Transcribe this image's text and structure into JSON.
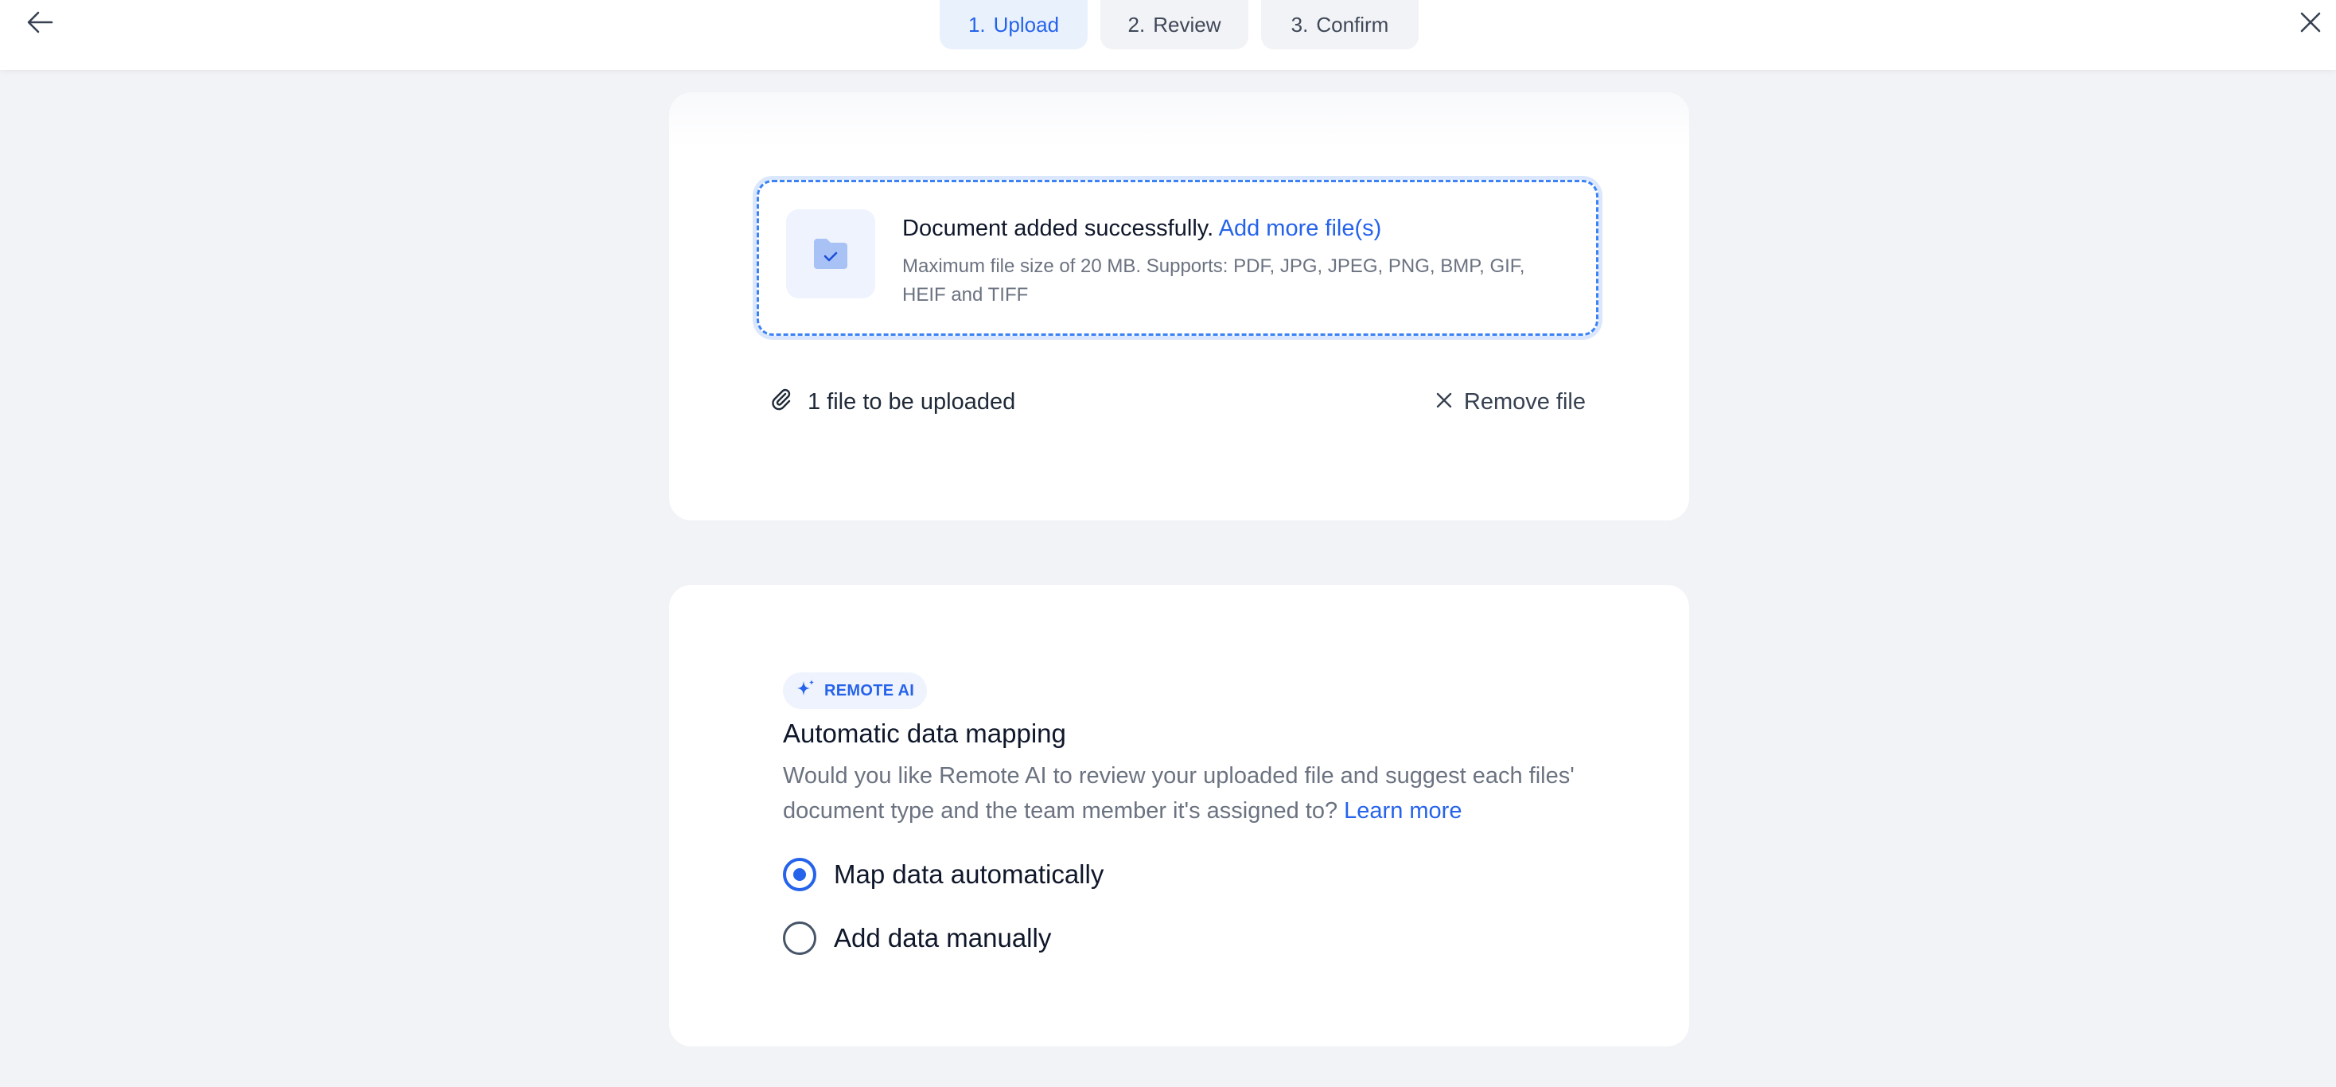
{
  "header": {
    "steps": [
      {
        "number": "1.",
        "label": "Upload",
        "active": true
      },
      {
        "number": "2.",
        "label": "Review",
        "active": false
      },
      {
        "number": "3.",
        "label": "Confirm",
        "active": false
      }
    ],
    "back_icon": "arrow-left-icon",
    "close_icon": "close-icon"
  },
  "upload": {
    "status_text": "Document added successfully.",
    "add_more_link": "Add more file(s)",
    "hint": "Maximum file size of 20 MB. Supports: PDF, JPG, JPEG, PNG, BMP, GIF, HEIF and TIFF",
    "file_count": "1 file to be uploaded",
    "remove_label": "Remove file",
    "folder_icon": "folder-check-icon",
    "paperclip_icon": "paperclip-icon"
  },
  "ai": {
    "badge": "REMOTE AI",
    "title": "Automatic data mapping",
    "description": "Would you like Remote AI to review your uploaded file and suggest each files' document type and the team member it's assigned to?",
    "learn_more": "Learn more",
    "options": [
      {
        "label": "Map data automatically",
        "selected": true
      },
      {
        "label": "Add data manually",
        "selected": false
      }
    ]
  },
  "colors": {
    "accent": "#2563eb",
    "background": "#f2f3f6",
    "muted_text": "#6b7280"
  }
}
